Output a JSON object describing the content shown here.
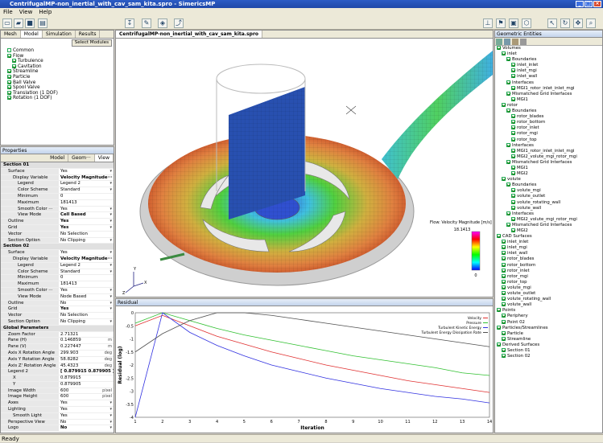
{
  "window": {
    "title": "CentrifugalMP-non_inertial_with_cav_sam_kita.spro - SimericsMP"
  },
  "menu": [
    "File",
    "View",
    "Help"
  ],
  "left_tabs": [
    "Mesh",
    "Model",
    "Simulation",
    "Results"
  ],
  "select_modules": "Select Modules",
  "model_tree": [
    {
      "label": "Common",
      "level": 1,
      "check": false
    },
    {
      "label": "Flow",
      "level": 1,
      "check": true
    },
    {
      "label": "Turbulence",
      "level": 2,
      "check": true
    },
    {
      "label": "Cavitation",
      "level": 2,
      "check": true
    },
    {
      "label": "Streamline",
      "level": 1,
      "check": true
    },
    {
      "label": "Particle",
      "level": 1,
      "check": true
    },
    {
      "label": "Ball Valve",
      "level": 1,
      "check": true
    },
    {
      "label": "Spool Valve",
      "level": 1,
      "check": true
    },
    {
      "label": "Translation (1 DOF)",
      "level": 1,
      "check": true
    },
    {
      "label": "Rotation (1 DOF)",
      "level": 1,
      "check": true
    }
  ],
  "properties": {
    "title": "Properties",
    "tabs": [
      "Model",
      "Geom···",
      "View"
    ],
    "rows": [
      {
        "k": "Section 01",
        "v": "",
        "sec": true
      },
      {
        "k": "Surface",
        "v": "Yes",
        "i": 1,
        "dd": true
      },
      {
        "k": "Display Variable",
        "v": "Velocity Magnitude···",
        "i": 2,
        "b": true
      },
      {
        "k": "Legend",
        "v": "Legend 2",
        "i": 3,
        "dd": true
      },
      {
        "k": "Color Scheme",
        "v": "Standard",
        "i": 3,
        "dd": true
      },
      {
        "k": "Minimum",
        "v": "0",
        "i": 3
      },
      {
        "k": "Maximum",
        "v": "181413",
        "i": 3
      },
      {
        "k": "Smooth Color ···",
        "v": "Yes",
        "i": 3,
        "dd": true
      },
      {
        "k": "View Mode",
        "v": "Cell Based",
        "i": 3,
        "b": true,
        "dd": true
      },
      {
        "k": "Outline",
        "v": "Yes",
        "i": 1,
        "b": true,
        "dd": true
      },
      {
        "k": "Grid",
        "v": "Yes",
        "i": 1,
        "b": true,
        "dd": true
      },
      {
        "k": "Vector",
        "v": "No Selection",
        "i": 1
      },
      {
        "k": "Section Option",
        "v": "No Clipping",
        "i": 1,
        "dd": true
      },
      {
        "k": "Section 02",
        "v": "",
        "sec": true
      },
      {
        "k": "Surface",
        "v": "Yes",
        "i": 1,
        "dd": true
      },
      {
        "k": "Display Variable",
        "v": "Velocity Magnitude···",
        "i": 2,
        "b": true
      },
      {
        "k": "Legend",
        "v": "Legend 2",
        "i": 3,
        "dd": true
      },
      {
        "k": "Color Scheme",
        "v": "Standard",
        "i": 3,
        "dd": true
      },
      {
        "k": "Minimum",
        "v": "0",
        "i": 3
      },
      {
        "k": "Maximum",
        "v": "181413",
        "i": 3
      },
      {
        "k": "Smooth Color ···",
        "v": "Yes",
        "i": 3,
        "dd": true
      },
      {
        "k": "View Mode",
        "v": "Node Based",
        "i": 3,
        "dd": true
      },
      {
        "k": "Outline",
        "v": "No",
        "i": 1,
        "dd": true
      },
      {
        "k": "Grid",
        "v": "Yes",
        "i": 1,
        "b": true,
        "dd": true
      },
      {
        "k": "Vector",
        "v": "No Selection",
        "i": 1
      },
      {
        "k": "Section Option",
        "v": "No Clipping",
        "i": 1,
        "dd": true
      },
      {
        "k": "Global Parameters",
        "v": "",
        "sec": true
      },
      {
        "k": "Zoom Factor",
        "v": "2.71321",
        "i": 1
      },
      {
        "k": "Pane (H)",
        "v": "0.146859",
        "i": 1,
        "u": "m"
      },
      {
        "k": "Pane (V)",
        "v": "0.227447",
        "i": 1,
        "u": "m"
      },
      {
        "k": "Axis X Rotation Angle",
        "v": "299.903",
        "i": 1,
        "u": "deg"
      },
      {
        "k": "Axis Y Rotation Angle",
        "v": "58.8282",
        "i": 1,
        "u": "deg"
      },
      {
        "k": "Axis Z' Rotation Angle",
        "v": "45.4323",
        "i": 1,
        "u": "deg"
      },
      {
        "k": "Legend 2",
        "v": "[ 0.879915 0.879905 ]",
        "i": 1,
        "b": true
      },
      {
        "k": "X",
        "v": "0.879915",
        "i": 2
      },
      {
        "k": "Y",
        "v": "0.879905",
        "i": 2
      },
      {
        "k": "Image Width",
        "v": "600",
        "i": 1,
        "u": "pixel"
      },
      {
        "k": "Image Height",
        "v": "600",
        "i": 1,
        "u": "pixel"
      },
      {
        "k": "Axes",
        "v": "Yes",
        "i": 1,
        "dd": true
      },
      {
        "k": "Lighting",
        "v": "Yes",
        "i": 1,
        "dd": true
      },
      {
        "k": "Smooth Light",
        "v": "Yes",
        "i": 2,
        "dd": true
      },
      {
        "k": "Perspective View",
        "v": "No",
        "i": 1,
        "dd": true
      },
      {
        "k": "Logo",
        "v": "No",
        "i": 1,
        "b": true,
        "dd": true
      }
    ]
  },
  "viewport": {
    "tab": "CentrifugalMP-non_inertial_with_cav_sam_kita.spro"
  },
  "legend": {
    "title": "Flow: Velocity Magnitude [m/s]",
    "max": "18.1413",
    "min": "0"
  },
  "axes": {
    "x": "X",
    "y": "Y",
    "z": "Z"
  },
  "residual": {
    "title": "Residual"
  },
  "chart_data": {
    "type": "line",
    "xlabel": "Iteration",
    "ylabel": "Residual (log)",
    "xlim": [
      1,
      14
    ],
    "ylim": [
      -4,
      0
    ],
    "xticks": [
      1,
      2,
      3,
      4,
      5,
      6,
      7,
      8,
      9,
      10,
      11,
      12,
      13,
      14
    ],
    "yticks": [
      0,
      -0.5,
      -1,
      -1.5,
      -2,
      -2.5,
      -3,
      -3.5,
      -4
    ],
    "legend_position": "top-right",
    "series": [
      {
        "name": "Velocity",
        "color": "#e03030",
        "x": [
          1,
          2,
          3,
          4,
          5,
          6,
          7,
          8,
          9,
          10,
          11,
          12,
          13,
          14
        ],
        "y": [
          -0.5,
          -0.1,
          -0.5,
          -0.9,
          -1.2,
          -1.5,
          -1.75,
          -2.0,
          -2.2,
          -2.4,
          -2.6,
          -2.75,
          -2.9,
          -3.05
        ]
      },
      {
        "name": "Pressure",
        "color": "#30c030",
        "x": [
          1,
          2,
          3,
          4,
          5,
          6,
          7,
          8,
          9,
          10,
          11,
          12,
          13,
          14
        ],
        "y": [
          -0.4,
          0,
          -0.3,
          -0.6,
          -0.85,
          -1.05,
          -1.25,
          -1.45,
          -1.65,
          -1.8,
          -1.95,
          -2.1,
          -2.3,
          -2.4
        ]
      },
      {
        "name": "Turbulent Kinetic Energy",
        "color": "#3030e0",
        "x": [
          1,
          2,
          3,
          4,
          5,
          6,
          7,
          8,
          9,
          10,
          11,
          12,
          13,
          14
        ],
        "y": [
          -4.0,
          0,
          -0.75,
          -1.25,
          -1.65,
          -2.0,
          -2.25,
          -2.5,
          -2.7,
          -2.9,
          -3.05,
          -3.2,
          -3.3,
          -3.45
        ]
      },
      {
        "name": "Turbulent Energy Dissipation Rate",
        "color": "#505050",
        "x": [
          1,
          2,
          3,
          4,
          5,
          6,
          7,
          8,
          9,
          10,
          11,
          12,
          13,
          14
        ],
        "y": [
          -1.5,
          -0.8,
          -0.3,
          0,
          0,
          -0.1,
          -0.25,
          -0.4,
          -0.55,
          -0.7,
          -0.85,
          -1.0,
          -1.15,
          -1.3
        ]
      }
    ]
  },
  "geo": {
    "title": "Geometric Entities",
    "tree": [
      {
        "t": "Volumes",
        "l": 0,
        "c": true
      },
      {
        "t": "inlet",
        "l": 1,
        "c": true
      },
      {
        "t": "Boundaries",
        "l": 2,
        "c": true
      },
      {
        "t": "inlet_inlet",
        "l": 3,
        "c": true
      },
      {
        "t": "inlet_mgi",
        "l": 3,
        "c": true
      },
      {
        "t": "inlet_wall",
        "l": 3,
        "c": true
      },
      {
        "t": "Interfaces",
        "l": 2,
        "c": true
      },
      {
        "t": "MGI1_rotor_inlet_inlet_mgi",
        "l": 3,
        "c": true
      },
      {
        "t": "Mismatched Grid Interfaces",
        "l": 2,
        "c": true
      },
      {
        "t": "MGI1",
        "l": 3,
        "c": true
      },
      {
        "t": "rotor",
        "l": 1,
        "c": true
      },
      {
        "t": "Boundaries",
        "l": 2,
        "c": true
      },
      {
        "t": "rotor_blades",
        "l": 3,
        "c": true
      },
      {
        "t": "rotor_bottom",
        "l": 3,
        "c": true
      },
      {
        "t": "rotor_inlet",
        "l": 3,
        "c": true
      },
      {
        "t": "rotor_mgi",
        "l": 3,
        "c": true
      },
      {
        "t": "rotor_top",
        "l": 3,
        "c": true
      },
      {
        "t": "Interfaces",
        "l": 2,
        "c": true
      },
      {
        "t": "MGI1_rotor_inlet_inlet_mgi",
        "l": 3,
        "c": true
      },
      {
        "t": "MGI2_volute_mgi_rotor_mgi",
        "l": 3,
        "c": true
      },
      {
        "t": "Mismatched Grid Interfaces",
        "l": 2,
        "c": true
      },
      {
        "t": "MGI1",
        "l": 3,
        "c": true
      },
      {
        "t": "MGI2",
        "l": 3,
        "c": true
      },
      {
        "t": "volute",
        "l": 1,
        "c": true
      },
      {
        "t": "Boundaries",
        "l": 2,
        "c": true
      },
      {
        "t": "volute_mgi",
        "l": 3,
        "c": true
      },
      {
        "t": "volute_outlet",
        "l": 3,
        "c": true
      },
      {
        "t": "volute_rotating_wall",
        "l": 3,
        "c": true
      },
      {
        "t": "volute_wall",
        "l": 3,
        "c": true
      },
      {
        "t": "Interfaces",
        "l": 2,
        "c": true
      },
      {
        "t": "MGI2_volute_mgi_rotor_mgi",
        "l": 3,
        "c": true
      },
      {
        "t": "Mismatched Grid Interfaces",
        "l": 2,
        "c": true
      },
      {
        "t": "MGI2",
        "l": 3,
        "c": true
      },
      {
        "t": "CAD Surfaces",
        "l": 0,
        "c": true
      },
      {
        "t": "inlet_inlet",
        "l": 1,
        "c": true
      },
      {
        "t": "inlet_mgi",
        "l": 1,
        "c": true
      },
      {
        "t": "inlet_wall",
        "l": 1,
        "c": true
      },
      {
        "t": "rotor_blades",
        "l": 1,
        "c": true
      },
      {
        "t": "rotor_bottom",
        "l": 1,
        "c": true
      },
      {
        "t": "rotor_inlet",
        "l": 1,
        "c": true
      },
      {
        "t": "rotor_mgi",
        "l": 1,
        "c": true
      },
      {
        "t": "rotor_top",
        "l": 1,
        "c": true
      },
      {
        "t": "volute_mgi",
        "l": 1,
        "c": true
      },
      {
        "t": "volute_outlet",
        "l": 1,
        "c": true
      },
      {
        "t": "volute_rotating_wall",
        "l": 1,
        "c": true
      },
      {
        "t": "volute_wall",
        "l": 1,
        "c": true
      },
      {
        "t": "Points",
        "l": 0,
        "c": true
      },
      {
        "t": "Periphery",
        "l": 1,
        "c": true
      },
      {
        "t": "Point 02",
        "l": 1,
        "c": true
      },
      {
        "t": "Particles/Streamlines",
        "l": 0,
        "c": true
      },
      {
        "t": "Particle",
        "l": 1,
        "c": true
      },
      {
        "t": "Streamline",
        "l": 1,
        "c": true
      },
      {
        "t": "Derived Surfaces",
        "l": 0,
        "c": true
      },
      {
        "t": "Section 01",
        "l": 1,
        "c": true
      },
      {
        "t": "Section 02",
        "l": 1,
        "c": true
      }
    ]
  },
  "status": "Ready"
}
